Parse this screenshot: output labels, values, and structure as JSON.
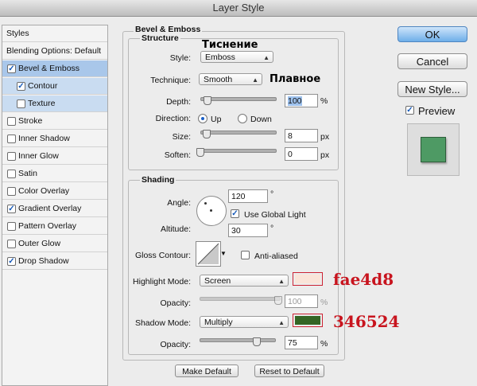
{
  "window": {
    "title": "Layer Style"
  },
  "styles_panel": {
    "header": "Styles",
    "items": [
      {
        "label": "Blending Options: Default",
        "checkbox": false,
        "checked": false
      },
      {
        "label": "Bevel & Emboss",
        "checkbox": true,
        "checked": true
      },
      {
        "label": "Contour",
        "checkbox": true,
        "checked": true
      },
      {
        "label": "Texture",
        "checkbox": true,
        "checked": false
      },
      {
        "label": "Stroke",
        "checkbox": true,
        "checked": false
      },
      {
        "label": "Inner Shadow",
        "checkbox": true,
        "checked": false
      },
      {
        "label": "Inner Glow",
        "checkbox": true,
        "checked": false
      },
      {
        "label": "Satin",
        "checkbox": true,
        "checked": false
      },
      {
        "label": "Color Overlay",
        "checkbox": true,
        "checked": false
      },
      {
        "label": "Gradient Overlay",
        "checkbox": true,
        "checked": true
      },
      {
        "label": "Pattern Overlay",
        "checkbox": true,
        "checked": false
      },
      {
        "label": "Outer Glow",
        "checkbox": true,
        "checked": false
      },
      {
        "label": "Drop Shadow",
        "checkbox": true,
        "checked": true
      }
    ]
  },
  "bevel": {
    "group_title": "Bevel & Emboss",
    "structure_title": "Structure",
    "style_label": "Style:",
    "style_value": "Emboss",
    "technique_label": "Technique:",
    "technique_value": "Smooth",
    "depth_label": "Depth:",
    "depth_value": "100",
    "depth_unit": "%",
    "depth_level": 0.1,
    "direction_label": "Direction:",
    "direction_up": "Up",
    "direction_down": "Down",
    "size_label": "Size:",
    "size_value": "8",
    "size_unit": "px",
    "soften_label": "Soften:",
    "soften_value": "0",
    "soften_unit": "px"
  },
  "shading": {
    "title": "Shading",
    "angle_label": "Angle:",
    "angle_value": "120",
    "angle_unit": "°",
    "use_global_light": "Use Global Light",
    "altitude_label": "Altitude:",
    "altitude_value": "30",
    "altitude_unit": "°",
    "gloss_label": "Gloss Contour:",
    "anti_aliased": "Anti-aliased",
    "highlight_mode_label": "Highlight Mode:",
    "highlight_mode_value": "Screen",
    "highlight_color": "#fae4d8",
    "highlight_opacity_label": "Opacity:",
    "highlight_opacity_value": "100",
    "opacity_unit": "%",
    "shadow_mode_label": "Shadow Mode:",
    "shadow_mode_value": "Multiply",
    "shadow_color": "#346524",
    "shadow_opacity_label": "Opacity:",
    "shadow_opacity_value": "75"
  },
  "buttons": {
    "make_default": "Make Default",
    "reset_default": "Reset to Default",
    "ok": "OK",
    "cancel": "Cancel",
    "new_style": "New Style...",
    "preview": "Preview"
  },
  "preview_color": "#4e9a64",
  "annotations": {
    "emboss_ru": "Тиснение",
    "smooth_ru": "Плавное",
    "highlight_hex": "fae4d8",
    "shadow_hex": "346524"
  }
}
